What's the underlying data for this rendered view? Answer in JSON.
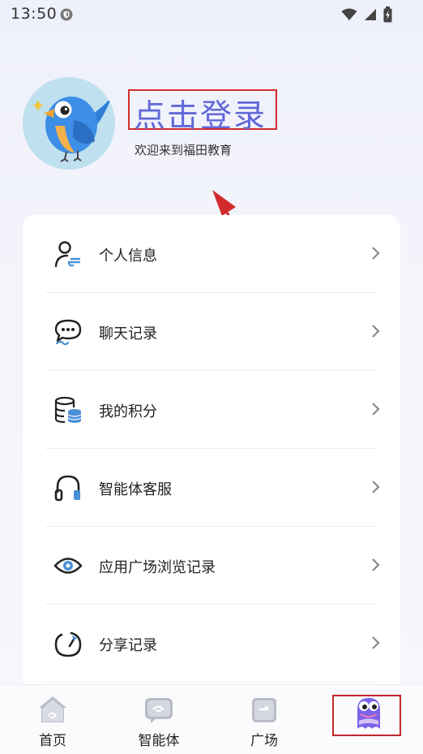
{
  "status_bar": {
    "time": "13:50"
  },
  "profile": {
    "login_label": "点击登录",
    "welcome_text": "欢迎来到福田教育"
  },
  "menu": {
    "items": [
      {
        "label": "个人信息",
        "icon": "person-icon"
      },
      {
        "label": "聊天记录",
        "icon": "chat-bubble-icon"
      },
      {
        "label": "我的积分",
        "icon": "database-icon"
      },
      {
        "label": "智能体客服",
        "icon": "headset-icon"
      },
      {
        "label": "应用广场浏览记录",
        "icon": "eye-icon"
      },
      {
        "label": "分享记录",
        "icon": "share-circle-icon"
      }
    ]
  },
  "bottom_nav": {
    "tabs": [
      {
        "label": "首页",
        "icon": "home-icon"
      },
      {
        "label": "智能体",
        "icon": "agent-icon"
      },
      {
        "label": "广场",
        "icon": "plaza-icon"
      },
      {
        "label": "",
        "icon": "mascot-icon"
      }
    ]
  },
  "colors": {
    "accent": "#6168d8",
    "annotation_red": "#d32b2b",
    "icon_blue": "#4a8fd8"
  }
}
